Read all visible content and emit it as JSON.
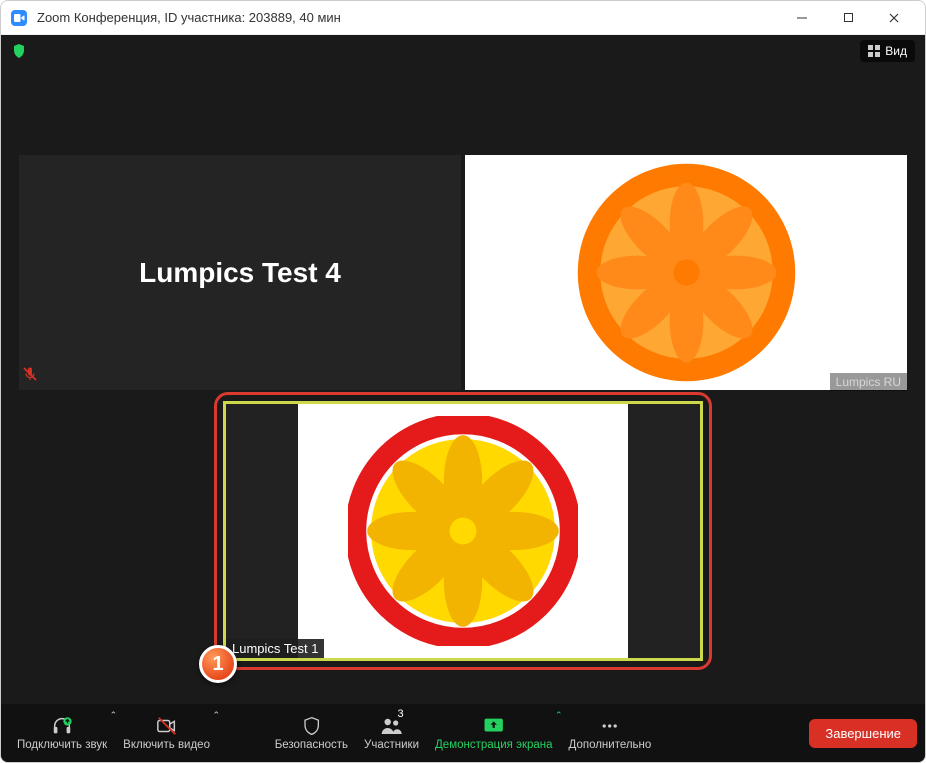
{
  "window": {
    "title": "Zoom Конференция, ID участника: 203889, 40 мин"
  },
  "topbar": {
    "view_label": "Вид"
  },
  "tiles": {
    "left_name": "Lumpics Test 4",
    "right_caption": "Lumpics RU"
  },
  "speaker": {
    "name": "Lumpics Test 1"
  },
  "callout": {
    "num": "1"
  },
  "toolbar": {
    "audio": "Подключить звук",
    "video": "Включить видео",
    "security": "Безопасность",
    "participants": "Участники",
    "participants_count": "3",
    "share": "Демонстрация экрана",
    "more": "Дополнительно",
    "end": "Завершение"
  },
  "colors": {
    "accent_green": "#23d160",
    "danger": "#d93025",
    "highlight_border": "#d83a2f",
    "speaker_border": "#cbd94a"
  }
}
